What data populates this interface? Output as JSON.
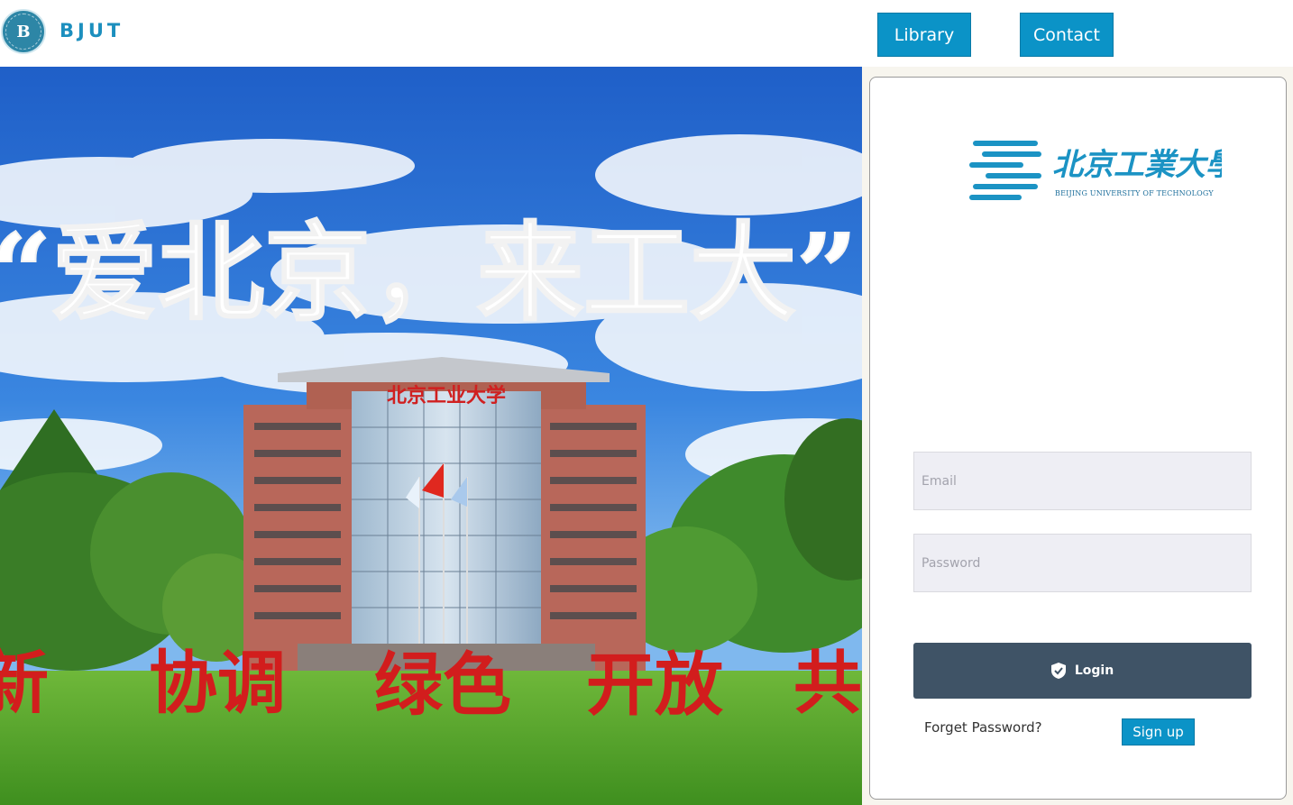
{
  "header": {
    "logo_icon": "bjut-seal-icon",
    "brand": "BJUT",
    "nav": [
      {
        "label": "Library"
      },
      {
        "label": "Contact"
      }
    ],
    "accent_color": "#0b93c7"
  },
  "hero": {
    "slogan": "“爱北京，来工大”",
    "building_sign": "北京工业大学",
    "ground_words": [
      "新",
      "协调",
      "绿色",
      "开放",
      "共"
    ]
  },
  "login": {
    "logo_cn": "北京工業大學",
    "logo_en": "BEIJING UNIVERSITY OF TECHNOLOGY",
    "email": {
      "placeholder": "Email",
      "value": ""
    },
    "password": {
      "placeholder": "Password",
      "value": ""
    },
    "login_label": "Login",
    "login_icon": "shield-check-icon",
    "forget_label": "Forget Password?",
    "signup_label": "Sign up",
    "button_color": "#3f5366"
  }
}
